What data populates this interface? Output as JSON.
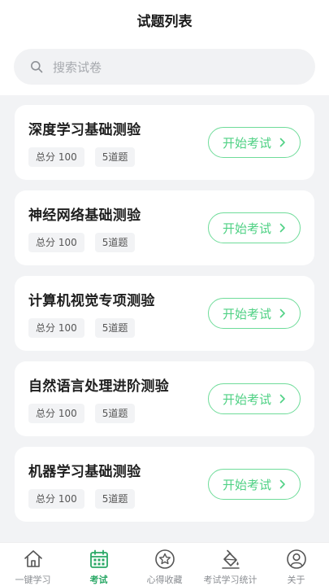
{
  "header": {
    "title": "试题列表"
  },
  "search": {
    "placeholder": "搜索试卷",
    "icon": "search-icon"
  },
  "exams": [
    {
      "name": "深度学习基础测验",
      "score": "总分 100",
      "count": "5道题",
      "action": "开始考试"
    },
    {
      "name": "神经网络基础测验",
      "score": "总分 100",
      "count": "5道题",
      "action": "开始考试"
    },
    {
      "name": "计算机视觉专项测验",
      "score": "总分 100",
      "count": "5道题",
      "action": "开始考试"
    },
    {
      "name": "自然语言处理进阶测验",
      "score": "总分 100",
      "count": "5道题",
      "action": "开始考试"
    },
    {
      "name": "机器学习基础测验",
      "score": "总分 100",
      "count": "5道题",
      "action": "开始考试"
    }
  ],
  "tabbar": {
    "items": [
      {
        "label": "一键学习",
        "icon": "home-icon",
        "active": false
      },
      {
        "label": "考试",
        "icon": "calendar-icon",
        "active": true
      },
      {
        "label": "心得收藏",
        "icon": "star-icon",
        "active": false
      },
      {
        "label": "考试学习统计",
        "icon": "paint-bucket-icon",
        "active": false
      },
      {
        "label": "关于",
        "icon": "user-icon",
        "active": false
      }
    ]
  },
  "colors": {
    "accent": "#4fd184",
    "accent_border": "#6fdc9a",
    "active_tab": "#2aa866",
    "background": "#f2f3f5"
  }
}
